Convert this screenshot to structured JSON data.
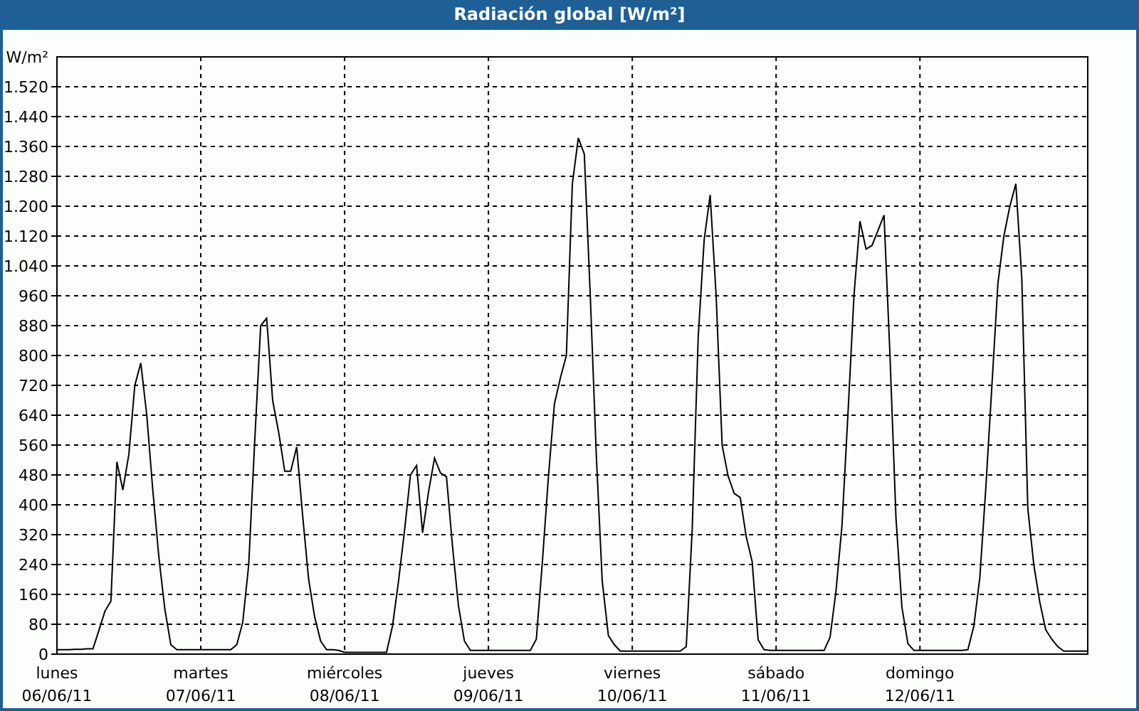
{
  "window": {
    "title": "Radiación global [W/m²]"
  },
  "chart": {
    "chart_data": {
      "type": "line",
      "grid": true,
      "ylabel": "W/m²",
      "ylim": [
        0,
        1600
      ],
      "yticks": [
        0,
        80,
        160,
        240,
        320,
        400,
        480,
        560,
        640,
        720,
        800,
        880,
        960,
        {
          "value": 1040,
          "label": "1.040"
        },
        {
          "value": 1120,
          "label": "1.120"
        },
        {
          "value": 1200,
          "label": "1.200"
        },
        {
          "value": 1280,
          "label": "1.280"
        },
        {
          "value": 1360,
          "label": "1.360"
        },
        {
          "value": 1440,
          "label": "1.440"
        },
        {
          "value": 1520,
          "label": "1.520"
        }
      ],
      "categories": [
        "lunes\n06/06/11",
        null,
        null,
        null,
        null,
        null,
        null,
        null,
        null,
        null,
        null,
        null,
        null,
        null,
        null,
        null,
        null,
        null,
        null,
        null,
        null,
        null,
        null,
        null,
        "martes\n07/06/11",
        null,
        null,
        null,
        null,
        null,
        null,
        null,
        null,
        null,
        null,
        null,
        null,
        null,
        null,
        null,
        null,
        null,
        null,
        null,
        null,
        null,
        null,
        null,
        "miércoles\n08/06/11",
        null,
        null,
        null,
        null,
        null,
        null,
        null,
        null,
        null,
        null,
        null,
        null,
        null,
        null,
        null,
        null,
        null,
        null,
        null,
        null,
        null,
        null,
        null,
        "jueves\n09/06/11",
        null,
        null,
        null,
        null,
        null,
        null,
        null,
        null,
        null,
        null,
        null,
        null,
        null,
        null,
        null,
        null,
        null,
        null,
        null,
        null,
        null,
        null,
        null,
        "viernes\n10/06/11",
        null,
        null,
        null,
        null,
        null,
        null,
        null,
        null,
        null,
        null,
        null,
        null,
        null,
        null,
        null,
        null,
        null,
        null,
        null,
        null,
        null,
        null,
        null,
        "sábado\n11/06/11",
        null,
        null,
        null,
        null,
        null,
        null,
        null,
        null,
        null,
        null,
        null,
        null,
        null,
        null,
        null,
        null,
        null,
        null,
        null,
        null,
        null,
        null,
        null,
        "domingo\n12/06/11",
        null,
        null,
        null,
        null,
        null,
        null,
        null,
        null,
        null,
        null,
        null,
        null,
        null,
        null,
        null,
        null,
        null,
        null,
        null,
        null,
        null,
        null,
        null,
        null,
        null,
        null,
        null,
        null
      ],
      "series": [
        {
          "color": "#000000",
          "values": [
            12,
            12,
            12,
            13,
            13,
            14,
            14,
            64,
            115,
            142,
            515,
            440,
            535,
            720,
            780,
            640,
            440,
            260,
            120,
            25,
            12,
            12,
            12,
            12,
            12,
            12,
            12,
            12,
            12,
            12,
            25,
            85,
            240,
            570,
            880,
            900,
            680,
            595,
            490,
            490,
            555,
            370,
            200,
            100,
            35,
            12,
            12,
            10,
            5,
            5,
            5,
            5,
            5,
            5,
            5,
            5,
            76,
            195,
            330,
            480,
            505,
            325,
            435,
            525,
            485,
            475,
            290,
            130,
            35,
            10,
            10,
            10,
            10,
            10,
            10,
            10,
            10,
            10,
            10,
            10,
            40,
            250,
            475,
            670,
            740,
            800,
            1260,
            1383,
            1340,
            960,
            535,
            195,
            50,
            25,
            8,
            8,
            8,
            8,
            8,
            8,
            8,
            8,
            8,
            8,
            8,
            20,
            335,
            850,
            1110,
            1230,
            960,
            560,
            477,
            430,
            420,
            315,
            248,
            38,
            12,
            10,
            10,
            10,
            10,
            10,
            10,
            10,
            10,
            10,
            10,
            45,
            170,
            345,
            645,
            960,
            1160,
            1085,
            1095,
            1135,
            1176,
            800,
            365,
            125,
            28,
            10,
            10,
            10,
            10,
            10,
            10,
            10,
            10,
            10,
            12,
            75,
            205,
            445,
            720,
            993,
            1120,
            1200,
            1260,
            1005,
            390,
            240,
            140,
            65,
            40,
            20,
            8,
            8,
            8,
            8,
            8
          ]
        }
      ]
    }
  }
}
